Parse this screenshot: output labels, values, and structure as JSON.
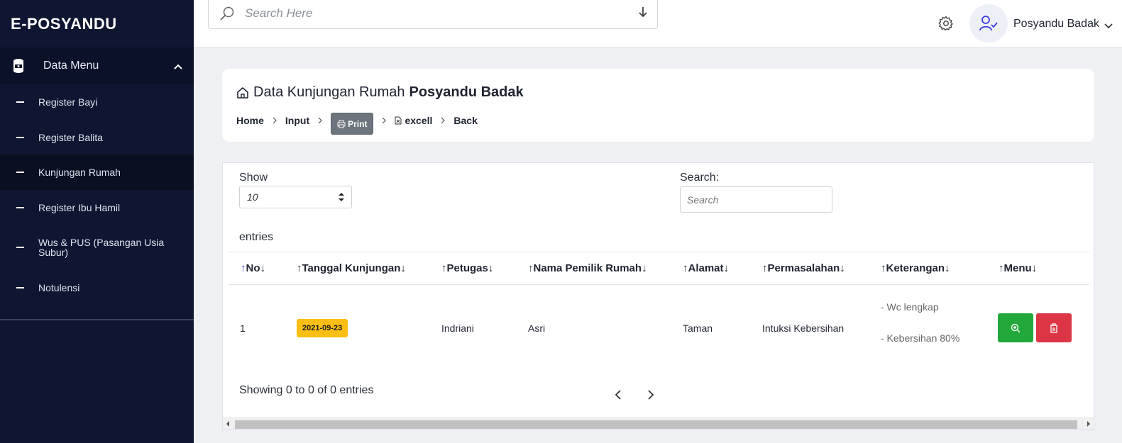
{
  "app": {
    "brand": "E-POSYANDU"
  },
  "sidebar": {
    "menu_label": "Data Menu",
    "items": [
      {
        "label": "Register Bayi"
      },
      {
        "label": "Register Balita"
      },
      {
        "label": "Kunjungan Rumah",
        "active": true
      },
      {
        "label": "Register Ibu Hamil"
      },
      {
        "label": "Wus & PUS (Pasangan Usia Subur)"
      },
      {
        "label": "Notulensi"
      }
    ]
  },
  "topbar": {
    "search_placeholder": "Search Here",
    "user_name": "Posyandu Badak"
  },
  "header": {
    "title": "Data Kunjungan Rumah",
    "title_bold": "Posyandu Badak",
    "breadcrumb": {
      "home": "Home",
      "input": "Input",
      "print": "Print",
      "excell": "excell",
      "back": "Back"
    }
  },
  "table": {
    "show_label": "Show",
    "page_size": "10",
    "entries_label": "entries",
    "search_label": "Search:",
    "search_placeholder": "Search",
    "columns": [
      "No",
      "Tanggal Kunjungan",
      "Petugas",
      "Nama Pemilik Rumah",
      "Alamat",
      "Permasalahan",
      "Keterangan",
      "Menu"
    ],
    "rows": [
      {
        "no": "1",
        "tanggal": "2021-09-23",
        "petugas": "Indriani",
        "nama": "Asri",
        "alamat": "Taman",
        "permasalahan": "Intuksi Kebersihan",
        "keterangan": [
          "- Wc lengkap",
          "- Kebersihan 80%"
        ]
      }
    ],
    "info": "Showing 0 to 0 of 0 entries"
  },
  "colors": {
    "sidebar_bg": "#0f1631",
    "badge": "#fbbf13",
    "view_btn": "#22a83a",
    "delete_btn": "#dc3545",
    "sort_active": "#3d3bdb"
  }
}
